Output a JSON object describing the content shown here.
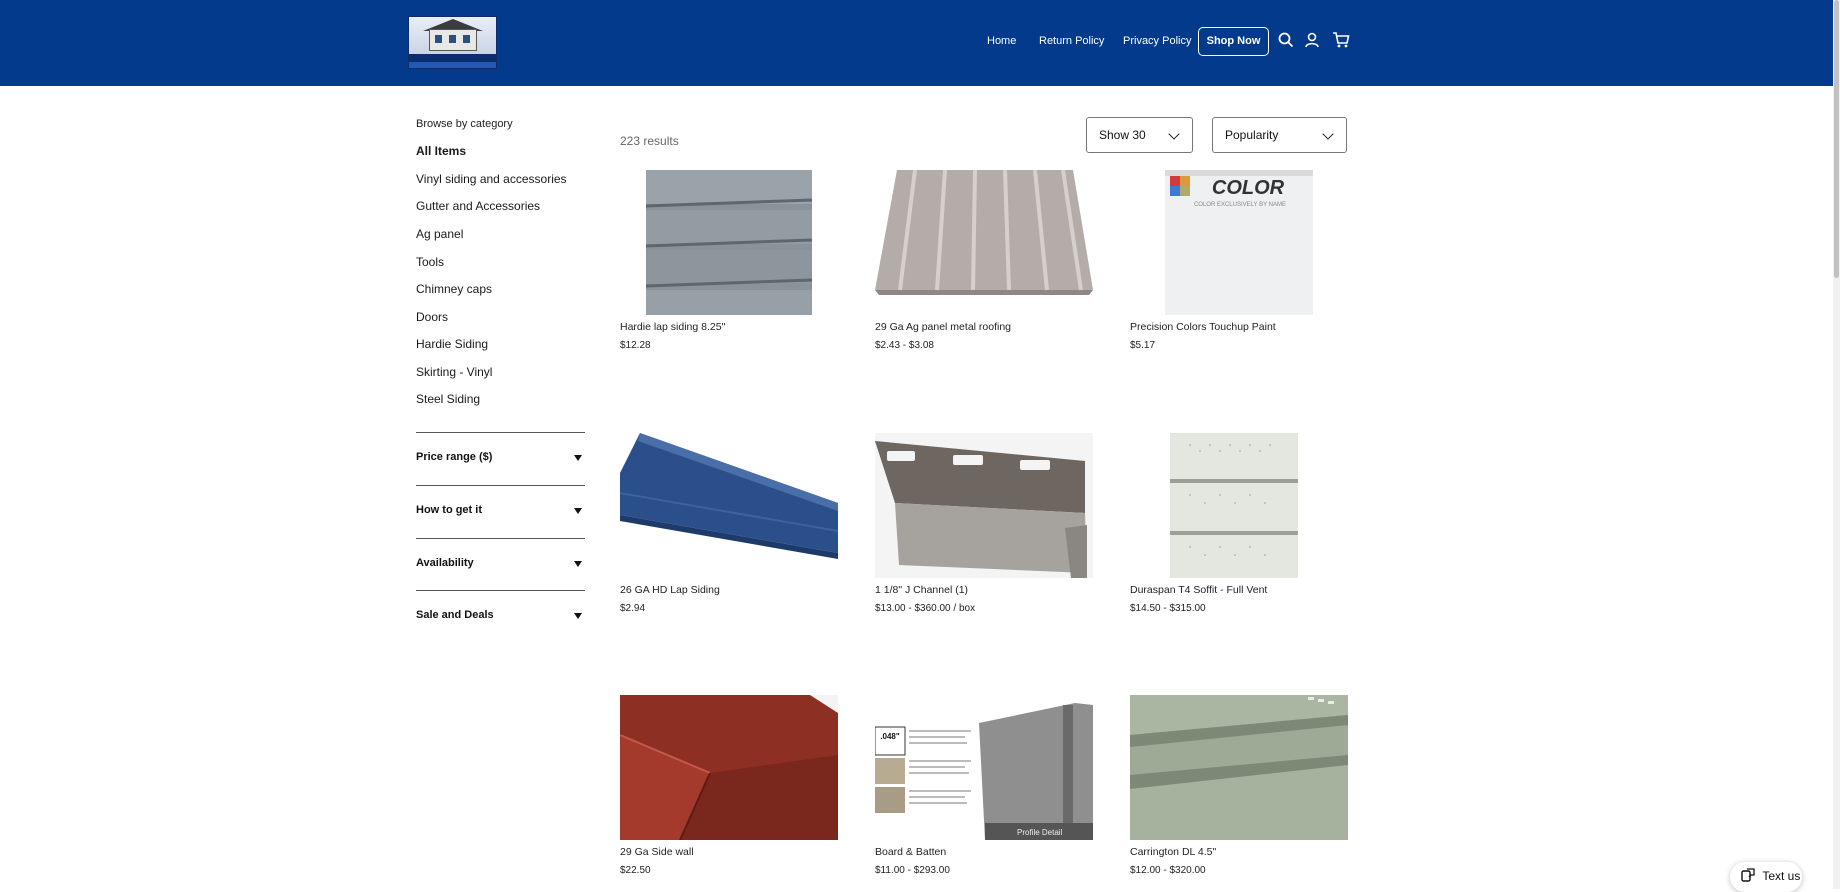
{
  "header": {
    "logo_alt": "Country siding logo",
    "nav": [
      "Home",
      "Return Policy",
      "Privacy Policy"
    ],
    "shop_now": "Shop Now",
    "icons": [
      "search-icon",
      "account-icon",
      "cart-icon"
    ],
    "brand_color": "#033a8c"
  },
  "sidebar": {
    "title": "Browse by category",
    "categories": [
      "All Items",
      "Vinyl siding and accessories",
      "Gutter and Accessories",
      "Ag panel",
      "Tools",
      "Chimney caps",
      "Doors",
      "Hardie Siding",
      "Skirting - Vinyl",
      "Steel Siding"
    ],
    "filters": [
      "Price range ($)",
      "How to get it",
      "Availability",
      "Sale and Deals"
    ]
  },
  "main": {
    "results": "223 results",
    "show": "Show 30",
    "sort": "Popularity",
    "products": [
      {
        "name": "Hardie lap siding 8.25\"",
        "price": "$12.28"
      },
      {
        "name": "29 Ga Ag panel metal roofing",
        "price": "$2.43 - $3.08"
      },
      {
        "name": "Precision Colors Touchup Paint",
        "price": "$5.17"
      },
      {
        "name": "26 GA HD Lap Siding",
        "price": "$2.94"
      },
      {
        "name": "1 1/8\" J Channel (1)",
        "price": "$13.00 - $360.00 / box"
      },
      {
        "name": "Duraspan T4 Soffit - Full Vent",
        "price": "$14.50 - $315.00"
      },
      {
        "name": "29 Ga Side wall",
        "price": "$22.50"
      },
      {
        "name": "Board & Batten",
        "price": "$11.00 - $293.00"
      },
      {
        "name": "Carrington DL 4.5\"",
        "price": "$12.00 - $320.00"
      }
    ],
    "image_text": {
      "paint_brand": "COLOR",
      "paint_sub": "COLOR EXCLUSIVELY BY NAME",
      "batten_badge": ".048\"",
      "batten_caption": "Profile Detail"
    }
  },
  "widget": {
    "text_us": "Text us"
  }
}
